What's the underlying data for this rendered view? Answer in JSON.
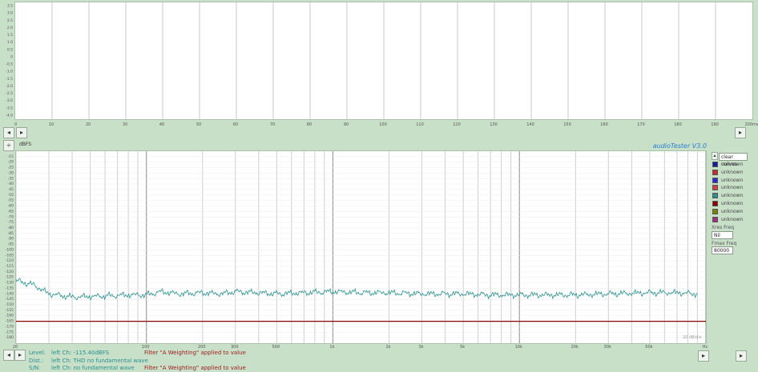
{
  "top_chart": {
    "y_ticks": [
      "3.5",
      "3.0",
      "2.5",
      "2.0",
      "1.5",
      "1.0",
      "0.5",
      "0",
      "-0.5",
      "-1.0",
      "-1.5",
      "-2.0",
      "-2.5",
      "-3.0",
      "-3.5",
      "-4.0"
    ],
    "x_ticks": [
      "0",
      "10",
      "20",
      "30",
      "40",
      "50",
      "60",
      "70",
      "80",
      "90",
      "100",
      "110",
      "120",
      "130",
      "140",
      "150",
      "160",
      "170",
      "180",
      "190",
      "200"
    ],
    "x_unit": "ms"
  },
  "bottom_chart": {
    "scale_label": "dBFS",
    "title": "audioTester  V3.0",
    "y_ticks": [
      "-15",
      "-20",
      "-25",
      "-30",
      "-35",
      "-40",
      "-45",
      "-50",
      "-55",
      "-60",
      "-65",
      "-70",
      "-75",
      "-80",
      "-85",
      "-90",
      "-95",
      "-100",
      "-105",
      "-110",
      "-115",
      "-120",
      "-125",
      "-130",
      "-135",
      "-140",
      "-145",
      "-150",
      "-155",
      "-160",
      "-165",
      "-170",
      "-175",
      "-180"
    ],
    "x_ticks": [
      {
        "label": "20",
        "f": 20
      },
      {
        "label": "100",
        "f": 100
      },
      {
        "label": "200",
        "f": 200
      },
      {
        "label": "300",
        "f": 300
      },
      {
        "label": "500",
        "f": 500
      },
      {
        "label": "1k",
        "f": 1000
      },
      {
        "label": "2k",
        "f": 2000
      },
      {
        "label": "3k",
        "f": 3000
      },
      {
        "label": "5k",
        "f": 5000
      },
      {
        "label": "10k",
        "f": 10000
      },
      {
        "label": "20k",
        "f": 20000
      },
      {
        "label": "30k",
        "f": 30000
      },
      {
        "label": "50k",
        "f": 50000
      },
      {
        "label": "Hz",
        "f": 100000
      }
    ],
    "corner_note": "20 dB/div"
  },
  "chart_data": {
    "type": "line",
    "title": "audioTester  V3.0",
    "xlabel": "Hz",
    "ylabel": "dBFS",
    "x_scale": "log",
    "xlim": [
      20,
      100000
    ],
    "ylim": [
      -185,
      -10
    ],
    "series": [
      {
        "color": "#2a9090",
        "x": [
          20,
          25,
          30,
          40,
          60,
          80,
          100,
          120,
          150,
          200,
          250,
          300,
          400,
          500,
          700,
          1000,
          1500,
          2000,
          3000,
          5000,
          7000,
          10000,
          15000,
          20000,
          30000,
          50000,
          70000,
          90000
        ],
        "values": [
          -128,
          -132,
          -140,
          -143,
          -142,
          -141,
          -141,
          -138,
          -140,
          -139,
          -140,
          -138,
          -139,
          -140,
          -139,
          -138,
          -139,
          -139,
          -140,
          -140,
          -141,
          -141,
          -141,
          -141,
          -140,
          -139,
          -139,
          -140
        ]
      },
      {
        "color": "#8b0000",
        "x": [
          20,
          100000
        ],
        "values": [
          -165,
          -165
        ]
      }
    ]
  },
  "legend": {
    "dropdown": "clear curves",
    "items": [
      {
        "label": "unknown",
        "color": "#1a1aa0"
      },
      {
        "label": "unknown",
        "color": "#c03030"
      },
      {
        "label": "unknown",
        "color": "#2a2ad0"
      },
      {
        "label": "unknown",
        "color": "#d04040"
      },
      {
        "label": "unknown",
        "color": "#2a9090"
      },
      {
        "label": "unknown",
        "color": "#8b0000"
      },
      {
        "label": "unknown",
        "color": "#808000"
      },
      {
        "label": "unknown",
        "color": "#a03080"
      }
    ],
    "xres_label": "Xres Freq",
    "xres_value": "Nil",
    "freq_label": "Fmax Freq",
    "freq_value": "80000"
  },
  "status": {
    "rows": [
      {
        "label": "Level:",
        "text": "left Ch: -115.40dBFS",
        "filter": "Filter \"A Weighting\" applied to value"
      },
      {
        "label": "Dist.:",
        "text": "left Ch: THD no fundamental wave",
        "filter": ""
      },
      {
        "label": "S/N:",
        "text": "left Ch: no fundamental wave",
        "filter": "Filter \"A Weighting\" applied to value"
      }
    ]
  }
}
